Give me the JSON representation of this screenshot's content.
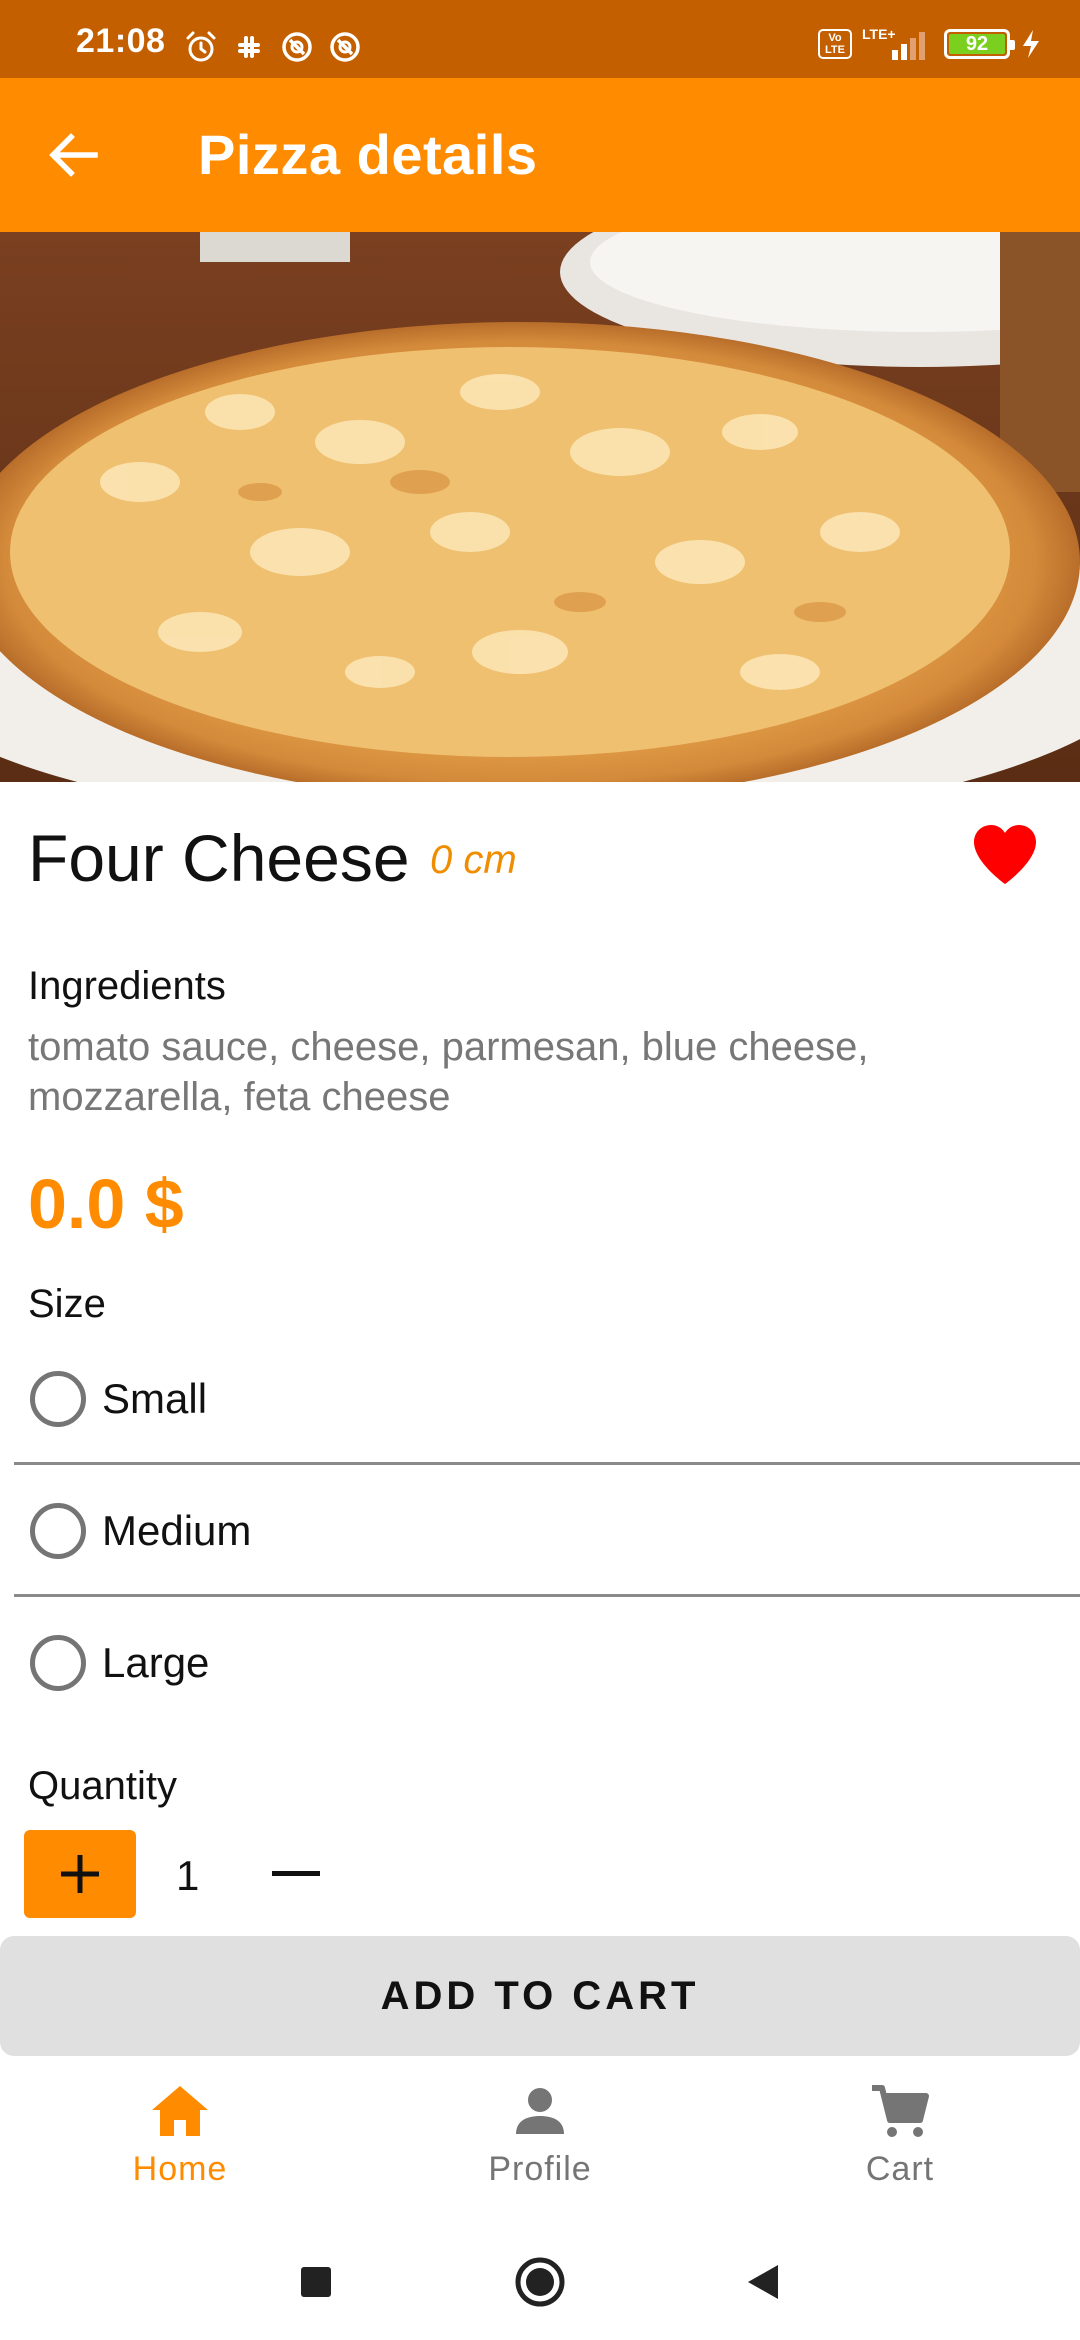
{
  "status_bar": {
    "time": "21:08",
    "volte_label": "Vo LTE",
    "network_label": "LTE+",
    "battery_level": "92",
    "icons": [
      "alarm-icon",
      "slack-icon",
      "app-notification-icon",
      "app-notification-icon",
      "volte-icon",
      "signal-icon",
      "battery-icon",
      "charging-icon"
    ]
  },
  "app_bar": {
    "title": "Pizza details",
    "back_icon": "arrow-back-icon"
  },
  "pizza": {
    "name": "Four Cheese",
    "size": "0 cm",
    "favorite": true,
    "ingredients_label": "Ingredients",
    "ingredients": "tomato sauce, cheese, parmesan, blue cheese, mozzarella, feta cheese",
    "price": "0.0 $"
  },
  "size_section": {
    "label": "Size",
    "options": [
      {
        "label": "Small",
        "selected": false
      },
      {
        "label": "Medium",
        "selected": false
      },
      {
        "label": "Large",
        "selected": false
      }
    ]
  },
  "quantity": {
    "label": "Quantity",
    "value": "1"
  },
  "add_to_cart_label": "ADD TO CART",
  "bottom_nav": {
    "items": [
      {
        "label": "Home",
        "icon": "home-icon",
        "active": true
      },
      {
        "label": "Profile",
        "icon": "person-icon",
        "active": false
      },
      {
        "label": "Cart",
        "icon": "shopping-cart-icon",
        "active": false
      }
    ]
  },
  "colors": {
    "accent": "#ff8c00",
    "status_bar": "#c45f00",
    "favorite": "#ff0000",
    "inactive_nav": "#757575"
  }
}
